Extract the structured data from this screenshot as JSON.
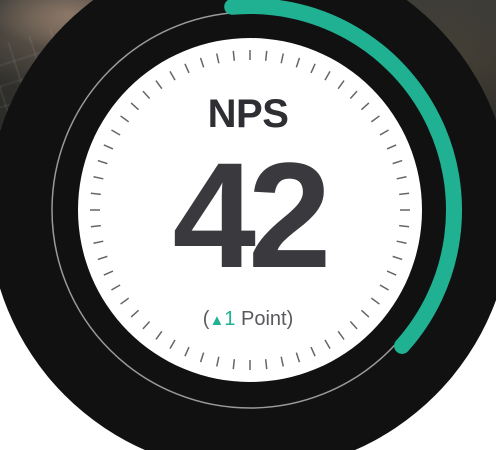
{
  "gauge": {
    "title": "NPS",
    "value": "42",
    "change_open": "(",
    "change_arrow": "▲",
    "change_value": "1",
    "change_unit": " Point)",
    "fill_fraction": 0.38,
    "colors": {
      "accent": "#1fb191",
      "ring": "#111111",
      "face": "#ffffff",
      "text": "#3a3a3e"
    }
  }
}
